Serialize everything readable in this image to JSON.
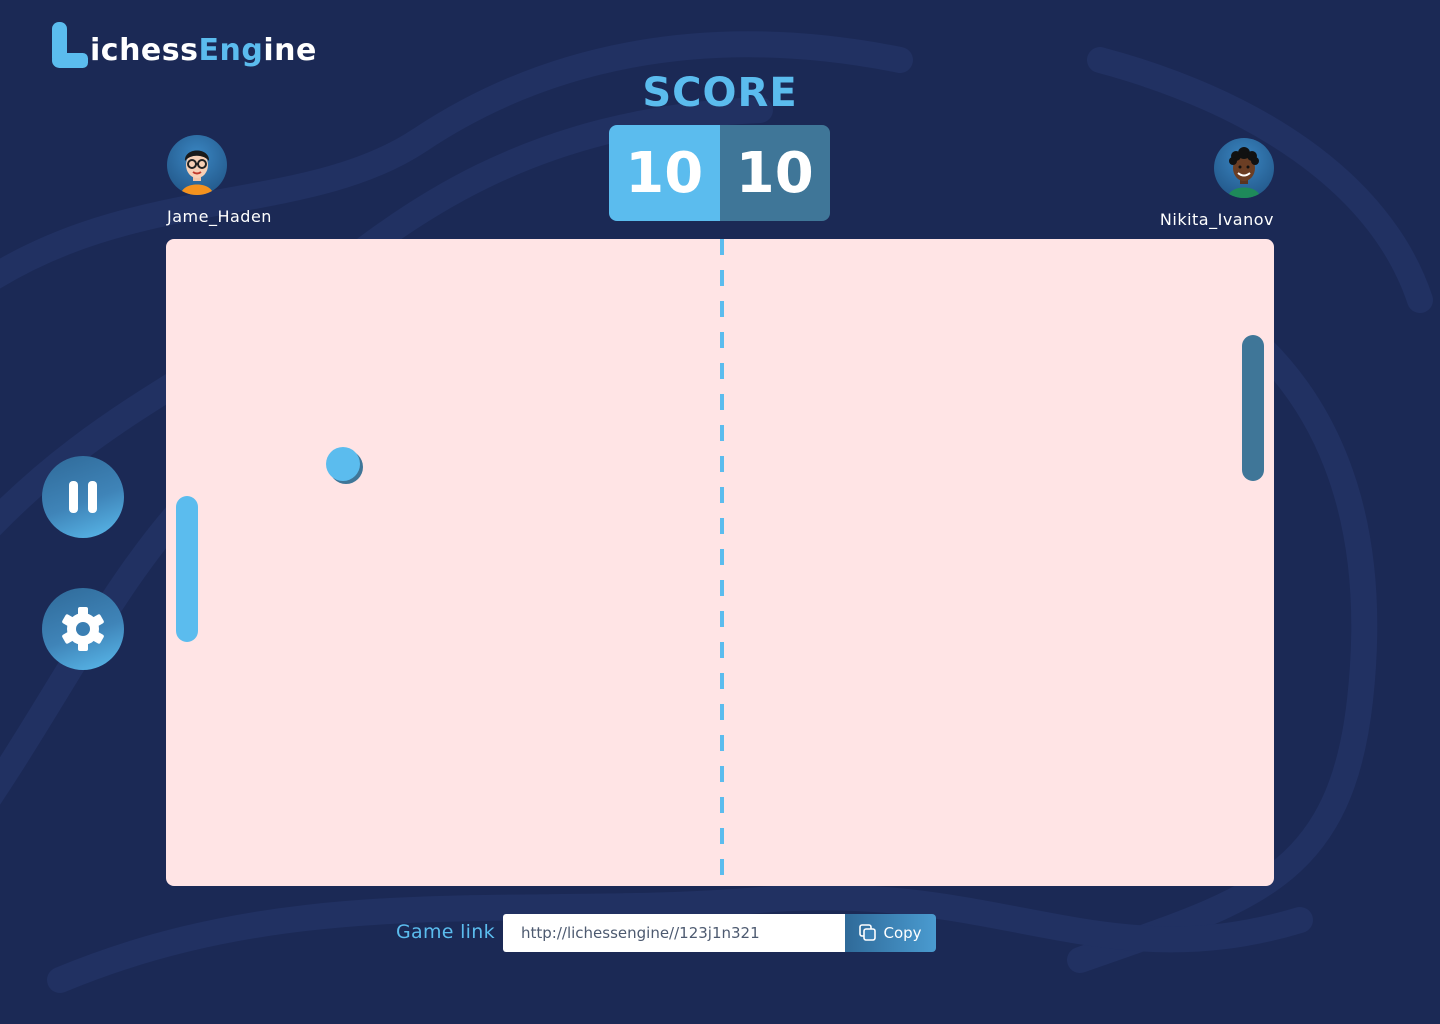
{
  "brand": {
    "part1": "ichess",
    "part2": "Eng",
    "part3": "ine"
  },
  "score": {
    "title": "SCORE",
    "left": "10",
    "right": "10"
  },
  "players": {
    "left": {
      "name": "Jame_Haden"
    },
    "right": {
      "name": "Nikita_Ivanov"
    }
  },
  "controls": {
    "pause_icon": "pause-icon",
    "settings_icon": "gear-icon"
  },
  "game_link": {
    "label": "Game link",
    "url": "http://lichessengine//123j1n321",
    "copy_label": "Copy"
  },
  "colors": {
    "background": "#1b2955",
    "accent": "#5bbcee",
    "accent_dark": "#3f7698",
    "board": "#ffe4e5"
  }
}
